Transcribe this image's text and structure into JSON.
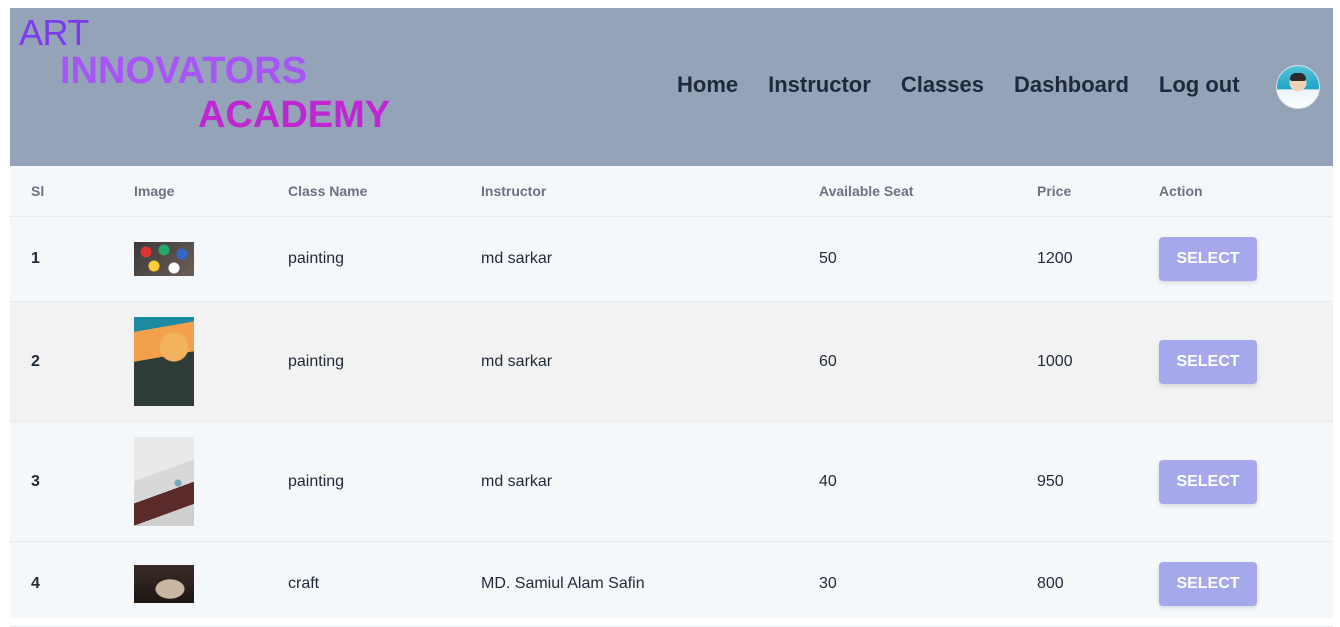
{
  "header": {
    "logo_line1": "ART",
    "logo_line2": "INNOVATORS",
    "logo_line3": "ACADEMY",
    "nav": [
      "Home",
      "Instructor",
      "Classes",
      "Dashboard",
      "Log out"
    ],
    "avatar_icon": "user-avatar"
  },
  "colors": {
    "navbar_bg": "#94a3b8",
    "logo_primary": "#7c3aed",
    "button_bg": "#a5a8ea"
  },
  "table": {
    "columns": [
      "Sl",
      "Image",
      "Class Name",
      "Instructor",
      "Available Seat",
      "Price",
      "Action"
    ],
    "rows": [
      {
        "sl": "1",
        "class_name": "painting",
        "instructor": "md sarkar",
        "seats": "50",
        "price": "1200",
        "action": "SELECT"
      },
      {
        "sl": "2",
        "class_name": "painting",
        "instructor": "md sarkar",
        "seats": "60",
        "price": "1000",
        "action": "SELECT"
      },
      {
        "sl": "3",
        "class_name": "painting",
        "instructor": "md sarkar",
        "seats": "40",
        "price": "950",
        "action": "SELECT"
      },
      {
        "sl": "4",
        "class_name": "craft",
        "instructor": "MD. Samiul Alam Safin",
        "seats": "30",
        "price": "800",
        "action": "SELECT"
      }
    ]
  }
}
